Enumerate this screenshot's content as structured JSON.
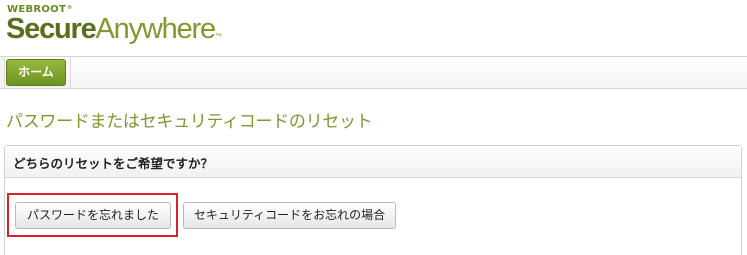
{
  "brand": {
    "company": "WEBROOT",
    "company_mark": "®",
    "product_primary": "Secure",
    "product_secondary": "Anywhere",
    "product_mark": "™"
  },
  "nav": {
    "home_label": "ホーム"
  },
  "page": {
    "title": "パスワードまたはセキュリティコードのリセット"
  },
  "panel": {
    "question": "どちらのリセットをご希望ですか？",
    "buttons": {
      "forgot_password": "パスワードを忘れました",
      "forgot_security_code": "セキュリティコードをお忘れの場合"
    }
  },
  "colors": {
    "brand_green": "#7a9a30",
    "highlight_red": "#d9212c"
  }
}
